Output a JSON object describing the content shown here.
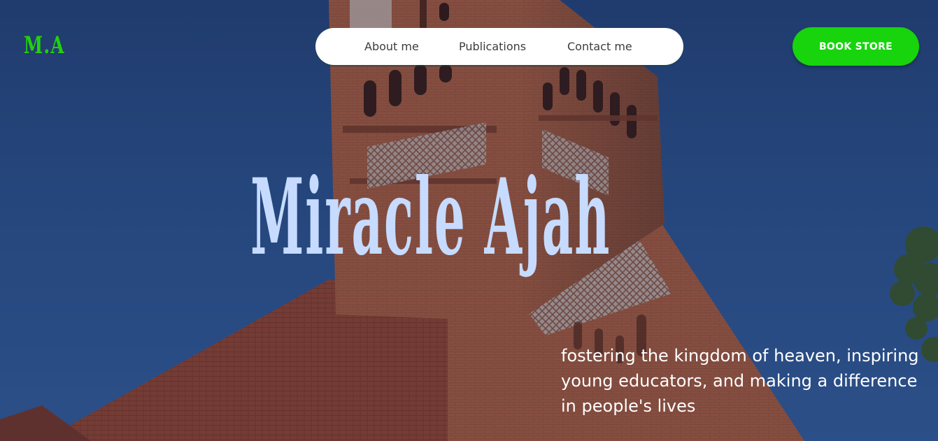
{
  "logo": {
    "text": "M.A",
    "color": "#22d10c"
  },
  "nav": {
    "items": [
      {
        "label": "About me"
      },
      {
        "label": "Publications"
      },
      {
        "label": "Contact me"
      }
    ]
  },
  "cta": {
    "label": "BOOK STORE",
    "color": "#17d40d"
  },
  "hero": {
    "title": "Miracle Ajah",
    "title_color": "#c6dbff",
    "tagline": "fostering the kingdom of heaven, inspiring young educators, and making a difference in people's lives",
    "background": "brick-church-tower-blue-sky"
  }
}
